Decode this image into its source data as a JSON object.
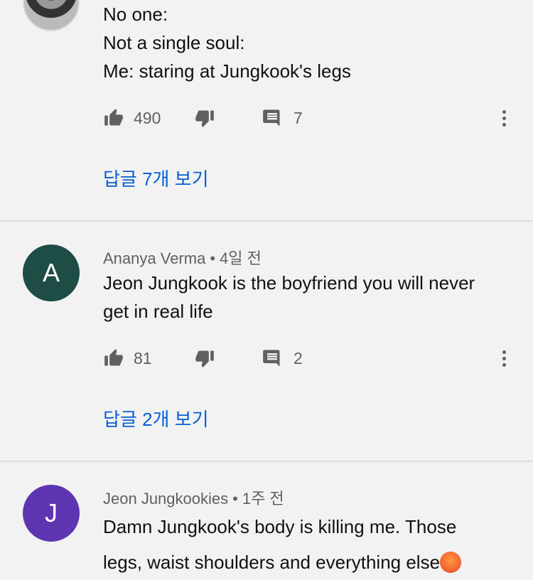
{
  "comments": [
    {
      "text_lines": [
        "No one:",
        "Not a single soul:",
        "Me: staring at Jungkook's legs"
      ],
      "likes": "490",
      "reply_count": "7",
      "view_replies": "답글 7개 보기"
    },
    {
      "author": "Ananya Verma",
      "separator": "•",
      "time": "4일 전",
      "avatar_letter": "A",
      "avatar_color": "#1e4d45",
      "text_lines": [
        "Jeon Jungkook is the boyfriend you will never",
        "get in real life"
      ],
      "likes": "81",
      "reply_count": "2",
      "view_replies": "답글 2개 보기"
    },
    {
      "author": "Jeon Jungkookies",
      "separator": "•",
      "time": "1주 전",
      "avatar_letter": "J",
      "avatar_color": "#5e35b1",
      "text_lines": [
        "Damn Jungkook's body is killing me. Those",
        "legs, waist shoulders and everything else"
      ],
      "emoji": "hot-face-emoji"
    }
  ],
  "icons": {
    "like": "thumbs-up-icon",
    "dislike": "thumbs-down-icon",
    "reply": "comment-icon",
    "more": "more-vert-icon"
  },
  "colors": {
    "link": "#065fd4",
    "background": "#f2f2f2",
    "secondary_text": "#606060"
  }
}
